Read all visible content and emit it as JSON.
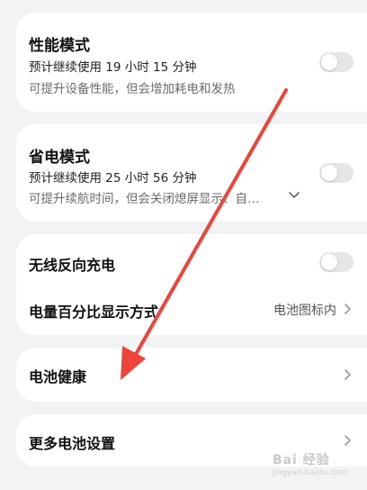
{
  "performance": {
    "title": "性能模式",
    "estimate": "预计继续使用 19 小时 15 分钟",
    "desc": "可提升设备性能，但会增加耗电和发热",
    "enabled": false
  },
  "power_saving": {
    "title": "省电模式",
    "estimate": "预计继续使用 25 小时 56 分钟",
    "desc": "可提升续航时间，但会关闭熄屏显示、自…",
    "enabled": false
  },
  "wireless_reverse": {
    "label": "无线反向充电",
    "enabled": false
  },
  "battery_percent": {
    "label": "电量百分比显示方式",
    "value": "电池图标内"
  },
  "battery_health": {
    "label": "电池健康"
  },
  "more_settings": {
    "label": "更多电池设置"
  },
  "annotation": {
    "color": "#f0443a"
  },
  "watermark": {
    "text": "Bai 经验",
    "sub": "jingyan.baidu.com"
  }
}
